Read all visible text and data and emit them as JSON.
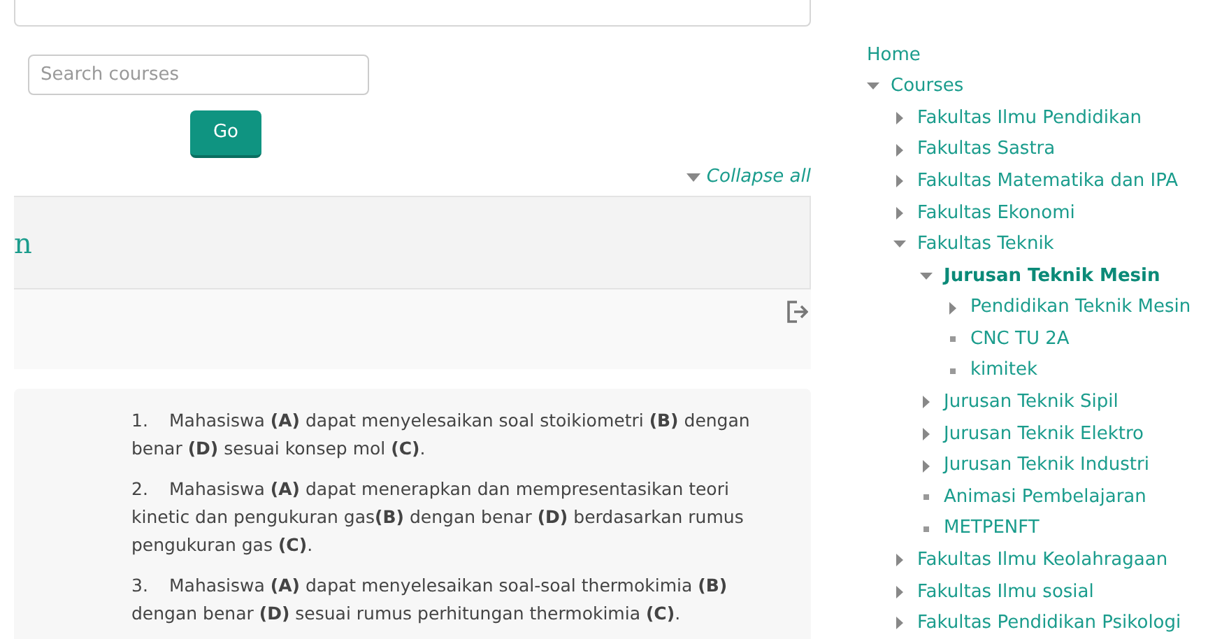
{
  "search": {
    "placeholder": "Search courses",
    "button": "Go"
  },
  "collapse_all": "Collapse all",
  "section": {
    "title": "n"
  },
  "objectives": [
    {
      "number": "1.",
      "text": "Mahasiswa **(A)** dapat menyelesaikan soal stoikiometri **(B)** dengan benar **(D)** sesuai konsep mol **(C)**."
    },
    {
      "number": "2.",
      "text": "Mahasiswa **(A)** dapat menerapkan dan mempresentasikan teori kinetic dan pengukuran gas**(B)** dengan benar **(D)** berdasarkan rumus pengukuran gas **(C)**."
    },
    {
      "number": "3.",
      "text": "Mahasiswa **(A)** dapat menyelesaikan soal-soal thermokimia **(B)** dengan benar **(D)** sesuai rumus perhitungan thermokimia **(C)**."
    }
  ],
  "navigation": [
    {
      "kind": "link",
      "label": "Home",
      "selected": false
    },
    {
      "kind": "branch",
      "label": "Courses",
      "expanded": true,
      "selected": false,
      "children": [
        {
          "kind": "branch",
          "label": "Fakultas Ilmu Pendidikan",
          "expanded": false,
          "selected": false
        },
        {
          "kind": "branch",
          "label": "Fakultas Sastra",
          "expanded": false,
          "selected": false
        },
        {
          "kind": "branch",
          "label": "Fakultas Matematika dan IPA",
          "expanded": false,
          "selected": false
        },
        {
          "kind": "branch",
          "label": "Fakultas Ekonomi",
          "expanded": false,
          "selected": false
        },
        {
          "kind": "branch",
          "label": "Fakultas Teknik",
          "expanded": true,
          "selected": false,
          "children": [
            {
              "kind": "branch",
              "label": "Jurusan Teknik Mesin",
              "expanded": true,
              "selected": true,
              "children": [
                {
                  "kind": "branch",
                  "label": "Pendidikan Teknik Mesin",
                  "expanded": false,
                  "selected": false
                },
                {
                  "kind": "leaf",
                  "label": "CNC TU 2A",
                  "selected": false
                },
                {
                  "kind": "leaf",
                  "label": "kimitek",
                  "selected": false
                }
              ]
            },
            {
              "kind": "branch",
              "label": "Jurusan Teknik Sipil",
              "expanded": false,
              "selected": false
            },
            {
              "kind": "branch",
              "label": "Jurusan Teknik Elektro",
              "expanded": false,
              "selected": false
            },
            {
              "kind": "branch",
              "label": "Jurusan Teknik Industri",
              "expanded": false,
              "selected": false
            },
            {
              "kind": "leaf",
              "label": "Animasi Pembelajaran",
              "selected": false
            },
            {
              "kind": "leaf",
              "label": "METPENFT",
              "selected": false
            }
          ]
        },
        {
          "kind": "branch",
          "label": "Fakultas Ilmu Keolahragaan",
          "expanded": false,
          "selected": false
        },
        {
          "kind": "branch",
          "label": "Fakultas Ilmu sosial",
          "expanded": false,
          "selected": false
        },
        {
          "kind": "branch",
          "label": "Fakultas Pendidikan Psikologi",
          "expanded": false,
          "selected": false
        }
      ]
    }
  ]
}
